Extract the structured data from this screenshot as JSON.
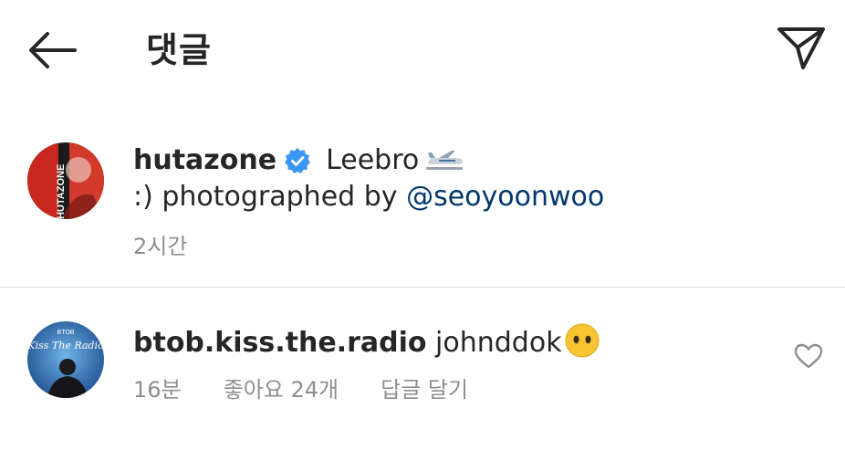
{
  "header": {
    "title": "댓글",
    "back_icon": "arrow-left-icon",
    "share_icon": "paper-plane-icon"
  },
  "caption": {
    "avatar_text": "HUTAZONE",
    "username": "hutazone",
    "verified_icon": "verified-badge-icon",
    "text_part1": "Leebro",
    "airplane_icon": "airplane-icon",
    "text_part2": ":) photographed by",
    "mention": "@seoyoonwoo",
    "time": "2시간"
  },
  "comment": {
    "avatar_text_top": "BTOB",
    "avatar_text": "Kiss The Radio",
    "username": "btob.kiss.the.radio",
    "text": "johnddok",
    "emoji_icon": "neutral-face-emoji-icon",
    "time": "16분",
    "likes": "좋아요 24개",
    "reply_label": "답글 달기",
    "heart_icon": "heart-outline-icon"
  },
  "colors": {
    "text": "#262626",
    "secondary": "#8e8e8e",
    "mention": "#00376b",
    "verified": "#3897f0",
    "divider": "#dbdbdb"
  }
}
